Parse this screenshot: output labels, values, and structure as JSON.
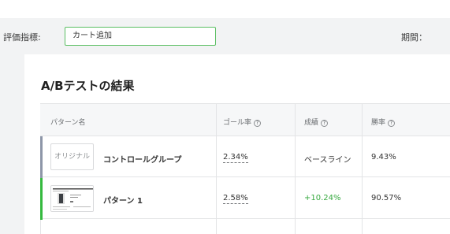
{
  "filters": {
    "metric_label": "評価指標:",
    "metric_value": "カート追加",
    "period_label": "期間："
  },
  "results": {
    "title": "A/Bテストの結果",
    "columns": {
      "pattern_name": "パターン名",
      "goal_rate": "ゴール率",
      "performance": "成績",
      "win_rate": "勝率"
    },
    "help_glyph": "?",
    "rows": [
      {
        "thumbnail_text": "オリジナル",
        "name": "コントロールグループ",
        "goal_rate": "2.34%",
        "performance": "ベースライン",
        "win_rate": "9.43%",
        "accent_color": "#8d96a8"
      },
      {
        "thumbnail_text": "",
        "name": "パターン 1",
        "goal_rate": "2.58%",
        "performance": "+10.24%",
        "win_rate": "90.57%",
        "accent_color": "#35b93f",
        "performance_color": "#36a93f"
      }
    ]
  }
}
